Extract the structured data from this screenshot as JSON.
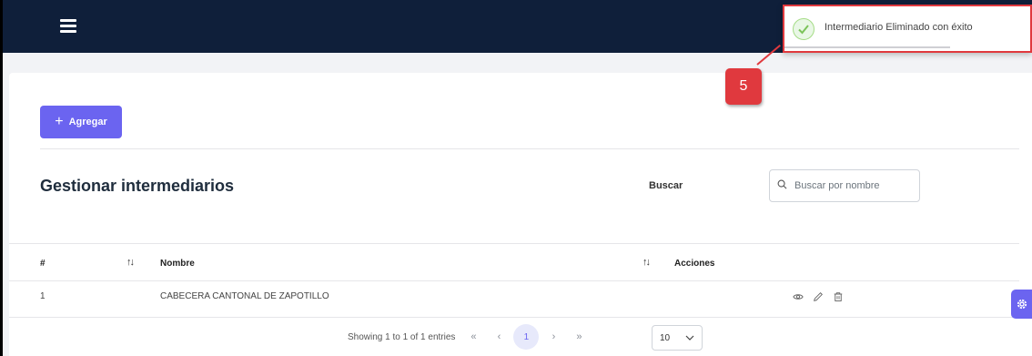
{
  "header": {
    "menu_icon": "hamburger-menu-icon"
  },
  "toolbar": {
    "add_label": "Agregar",
    "add_icon": "plus-icon"
  },
  "page": {
    "title": "Gestionar intermediarios"
  },
  "search": {
    "label": "Buscar",
    "placeholder": "Buscar por nombre",
    "icon": "search-icon"
  },
  "table": {
    "columns": {
      "index": "#",
      "name": "Nombre",
      "actions": "Acciones"
    },
    "rows": [
      {
        "index": "1",
        "name": "CABECERA CANTONAL DE ZAPOTILLO",
        "actions": [
          "eye-icon",
          "pencil-icon",
          "trash-icon"
        ]
      }
    ]
  },
  "pagination": {
    "summary": "Showing 1 to 1 of 1 entries",
    "first": "«",
    "prev": "‹",
    "current_page": "1",
    "next": "›",
    "last": "»",
    "per_page": "10"
  },
  "toast": {
    "message": "Intermediario Eliminado con éxito",
    "icon": "success-check-icon"
  },
  "annotation": {
    "step_number": "5"
  },
  "colors": {
    "accent": "#6b64f0",
    "header_bg": "#0f1f3a",
    "annotation_red": "#e0393e",
    "success_green": "#a5dc86"
  }
}
